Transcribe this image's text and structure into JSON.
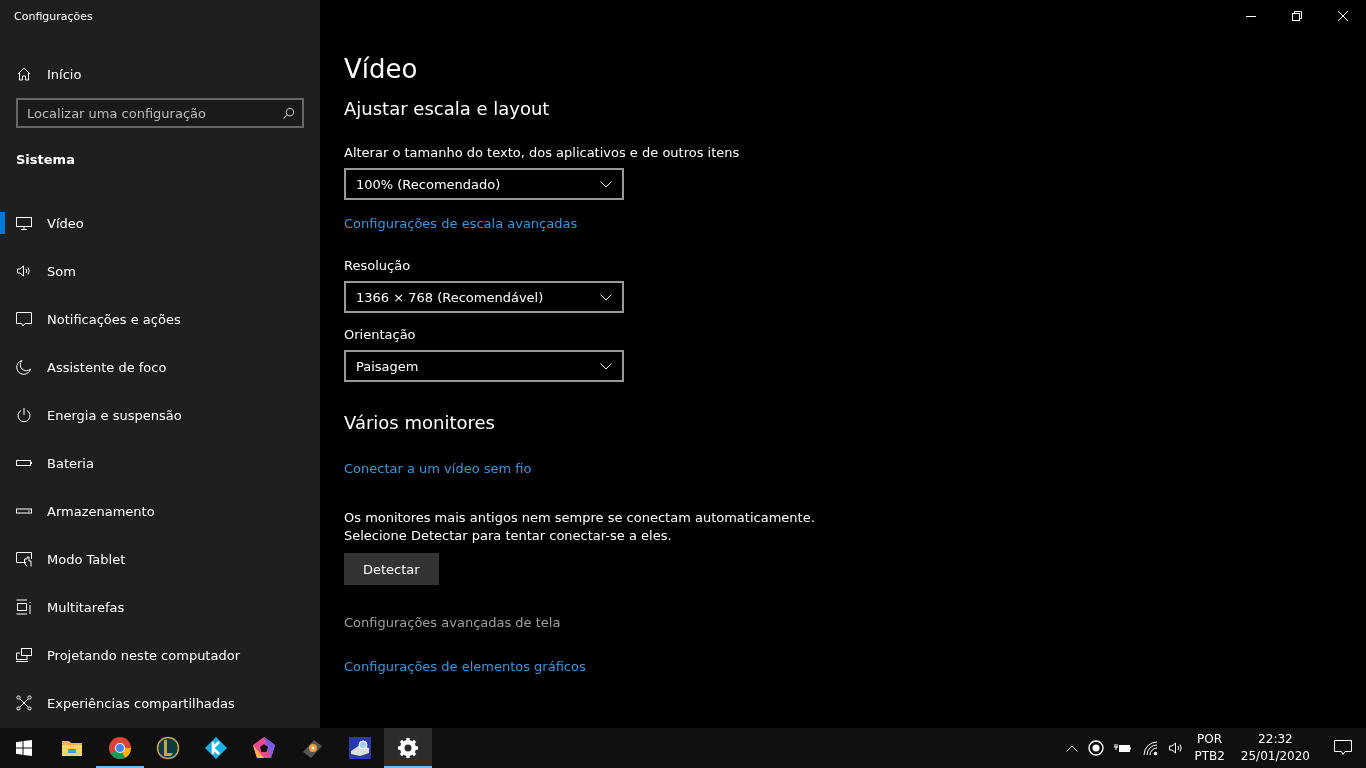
{
  "window": {
    "title": "Configurações"
  },
  "sidebar": {
    "home": "Início",
    "search": {
      "placeholder": "Localizar uma configuração"
    },
    "section": "Sistema",
    "items": [
      {
        "label": "Vídeo",
        "selected": true
      },
      {
        "label": "Som",
        "selected": false
      },
      {
        "label": "Notificações e ações",
        "selected": false
      },
      {
        "label": "Assistente de foco",
        "selected": false
      },
      {
        "label": "Energia e suspensão",
        "selected": false
      },
      {
        "label": "Bateria",
        "selected": false
      },
      {
        "label": "Armazenamento",
        "selected": false
      },
      {
        "label": "Modo Tablet",
        "selected": false
      },
      {
        "label": "Multitarefas",
        "selected": false
      },
      {
        "label": "Projetando neste computador",
        "selected": false
      },
      {
        "label": "Experiências compartilhadas",
        "selected": false
      }
    ]
  },
  "page": {
    "title": "Vídeo",
    "blocks": [
      {
        "kind": "heading",
        "text": "Ajustar escala e layout"
      },
      {
        "kind": "label",
        "text": "Alterar o tamanho do texto, dos aplicativos e de outros itens"
      },
      {
        "kind": "dropdown",
        "text": "100% (Recomendado)"
      },
      {
        "kind": "link",
        "text": "Configurações de escala avançadas",
        "disabled": false
      },
      {
        "kind": "label",
        "text": "Resolução"
      },
      {
        "kind": "dropdown",
        "text": "1366 × 768 (Recomendável)"
      },
      {
        "kind": "label",
        "text": "Orientação"
      },
      {
        "kind": "dropdown",
        "text": "Paisagem"
      },
      {
        "kind": "heading",
        "text": "Vários monitores"
      },
      {
        "kind": "link",
        "text": "Conectar a um vídeo sem fio",
        "disabled": false
      },
      {
        "kind": "text",
        "text": "Os monitores mais antigos nem sempre se conectam automaticamente.\nSelecione Detectar para tentar conectar-se a eles."
      },
      {
        "kind": "button",
        "text": "Detectar"
      },
      {
        "kind": "link",
        "text": "Configurações avançadas de tela",
        "disabled": true
      },
      {
        "kind": "link",
        "text": "Configurações de elementos gráficos",
        "disabled": false
      }
    ]
  },
  "taskbar": {
    "apps": [
      {
        "running": false,
        "selected": false
      },
      {
        "running": true,
        "selected": false
      },
      {
        "running": false,
        "selected": false
      },
      {
        "running": false,
        "selected": false
      },
      {
        "running": false,
        "selected": false
      },
      {
        "running": false,
        "selected": false
      },
      {
        "running": false,
        "selected": false
      },
      {
        "running": true,
        "selected": true
      }
    ],
    "language": "POR",
    "layout": "PTB2",
    "time": "22:32",
    "date": "25/01/2020"
  }
}
